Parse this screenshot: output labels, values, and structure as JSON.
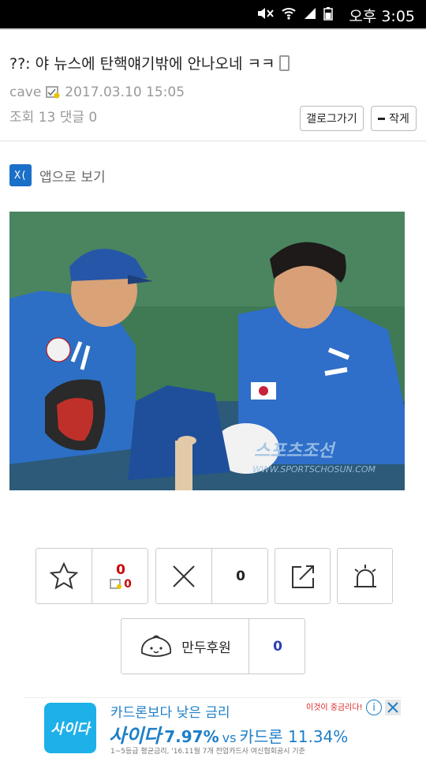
{
  "status": {
    "time": "오후 3:05"
  },
  "post": {
    "title": "??: 야 뉴스에 탄핵얘기밖에 안나오네 ㅋㅋ",
    "author": "cave",
    "datetime": "2017.03.10 15:05",
    "views_label": "조회",
    "views": "13",
    "comments_label": "댓글",
    "comments": "0"
  },
  "buttons": {
    "gallery": "갤로그가기",
    "small": "작게"
  },
  "appview": {
    "logo": "X(",
    "label": "앱으로 보기"
  },
  "photo": {
    "watermark": "스포츠조선",
    "watermark_url": "WWW.SPORTSCHOSUN.COM"
  },
  "actions": {
    "recommend_count": "0",
    "recommend_fixed": "0",
    "decline_count": "0",
    "donate_label": "만두후원",
    "donate_count": "0"
  },
  "ad": {
    "headline": "카드론보다 낮은 금리",
    "tag": "이것이 중금리다!",
    "logo": "사이다",
    "brand": "사이다",
    "rate": "7.97%",
    "vs": "vs",
    "compare": "카드론 11.34%",
    "note": "1~5등급 평균금리, '16.11월 7개 전업카드사 여신협회공시 기준"
  }
}
